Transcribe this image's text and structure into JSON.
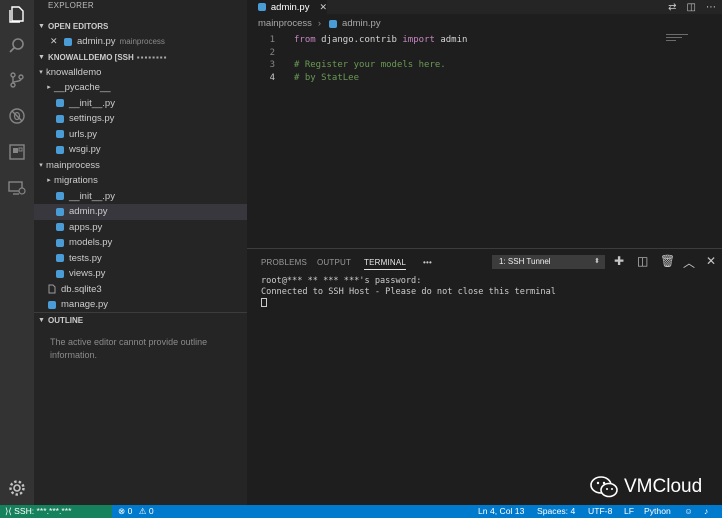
{
  "sidebar": {
    "title": "EXPLORER",
    "open_editors_header": "OPEN EDITORS",
    "open_editor": {
      "close": "✕",
      "name": "admin.py",
      "folder": "mainprocess"
    },
    "workspace_header": "KNOWALLDEMO [SSH",
    "tree": [
      {
        "label": "knowalldemo",
        "type": "folder-open",
        "indent": 0
      },
      {
        "label": "__pycache__",
        "type": "folder-closed",
        "indent": 1
      },
      {
        "label": "__init__.py",
        "type": "py",
        "indent": 1
      },
      {
        "label": "settings.py",
        "type": "py",
        "indent": 1
      },
      {
        "label": "urls.py",
        "type": "py",
        "indent": 1
      },
      {
        "label": "wsgi.py",
        "type": "py",
        "indent": 1
      },
      {
        "label": "mainprocess",
        "type": "folder-open",
        "indent": 0
      },
      {
        "label": "migrations",
        "type": "folder-closed",
        "indent": 1
      },
      {
        "label": "__init__.py",
        "type": "py",
        "indent": 1
      },
      {
        "label": "admin.py",
        "type": "py",
        "indent": 1,
        "selected": true
      },
      {
        "label": "apps.py",
        "type": "py",
        "indent": 1
      },
      {
        "label": "models.py",
        "type": "py",
        "indent": 1
      },
      {
        "label": "tests.py",
        "type": "py",
        "indent": 1
      },
      {
        "label": "views.py",
        "type": "py",
        "indent": 1
      },
      {
        "label": "db.sqlite3",
        "type": "file",
        "indent": -1
      },
      {
        "label": "manage.py",
        "type": "py",
        "indent": -1
      }
    ],
    "outline_header": "OUTLINE",
    "outline_message": "The active editor cannot provide outline information."
  },
  "editor": {
    "tab_name": "admin.py",
    "breadcrumb_folder": "mainprocess",
    "breadcrumb_file": "admin.py",
    "lines": [
      {
        "num": "1",
        "segments": [
          {
            "t": "from",
            "c": "kw"
          },
          {
            "t": " django.contrib ",
            "c": ""
          },
          {
            "t": "import",
            "c": "kw"
          },
          {
            "t": " admin",
            "c": ""
          }
        ]
      },
      {
        "num": "2",
        "segments": []
      },
      {
        "num": "3",
        "segments": [
          {
            "t": "# Register your models here.",
            "c": "cm"
          }
        ]
      },
      {
        "num": "4",
        "segments": [
          {
            "t": "# by StatLee",
            "c": "cm"
          }
        ]
      }
    ]
  },
  "panel": {
    "tabs": [
      "PROBLEMS",
      "OUTPUT",
      "TERMINAL"
    ],
    "more": "•••",
    "terminal_select": "1: SSH Tunnel",
    "terminal_lines": [
      "root@*** ** *** ***'s password:",
      "Connected to SSH Host - Please do not close this terminal"
    ]
  },
  "status": {
    "remote": "SSH: ***.***.***",
    "errors": "0",
    "warnings": "0",
    "position": "Ln 4, Col 13",
    "spaces": "Spaces: 4",
    "encoding": "UTF-8",
    "eol": "LF",
    "language": "Python"
  },
  "watermark": "VMCloud",
  "colors": {
    "activity_bar": "#333333",
    "sidebar": "#252526",
    "editor": "#1e1e1e",
    "status_bar": "#007acc",
    "remote_indicator": "#16825d",
    "python_icon": "#4a9cd6",
    "keyword": "#c586c0",
    "comment": "#6a9955"
  }
}
